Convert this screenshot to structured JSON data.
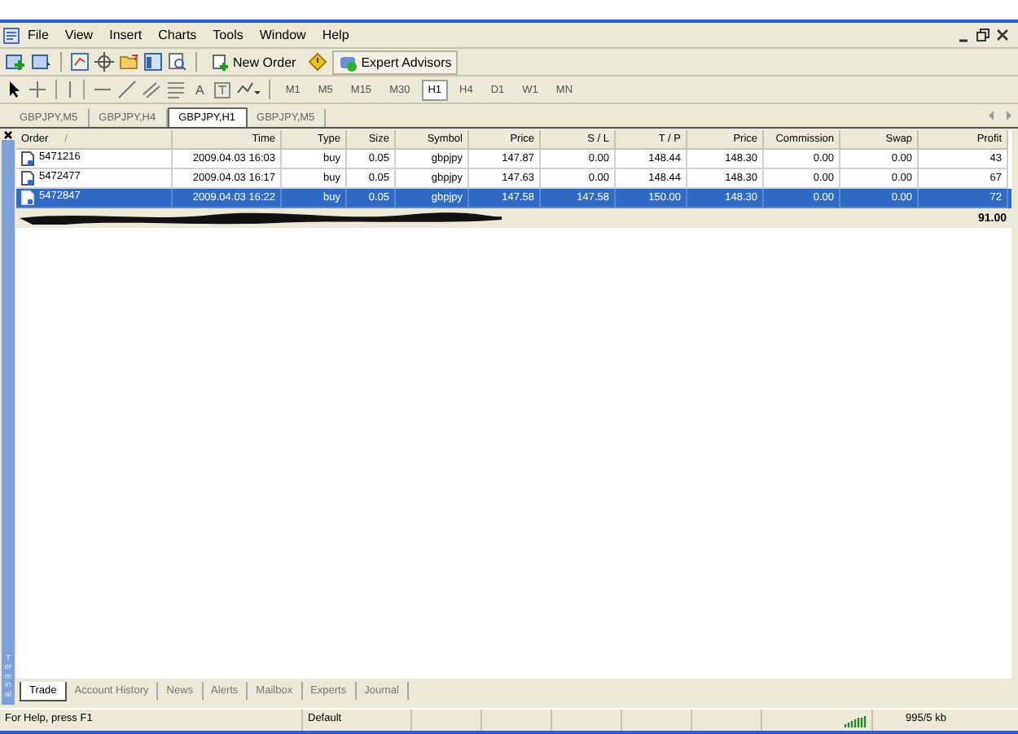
{
  "menu": [
    "File",
    "View",
    "Insert",
    "Charts",
    "Tools",
    "Window",
    "Help"
  ],
  "toolbar": {
    "new_order": "New Order",
    "expert_advisors": "Expert Advisors"
  },
  "draw_tools": {
    "text_tool": "A"
  },
  "timeframes": [
    {
      "label": "M1",
      "selected": false
    },
    {
      "label": "M5",
      "selected": false
    },
    {
      "label": "M15",
      "selected": false
    },
    {
      "label": "M30",
      "selected": false
    },
    {
      "label": "H1",
      "selected": true
    },
    {
      "label": "H4",
      "selected": false
    },
    {
      "label": "D1",
      "selected": false
    },
    {
      "label": "W1",
      "selected": false
    },
    {
      "label": "MN",
      "selected": false
    }
  ],
  "chart_tabs": [
    {
      "label": "GBPJPY,M5",
      "selected": false
    },
    {
      "label": "GBPJPY,H4",
      "selected": false
    },
    {
      "label": "GBPJPY,H1",
      "selected": true
    },
    {
      "label": "GBPJPY,M5",
      "selected": false
    }
  ],
  "terminal": {
    "side_label": "Terminal",
    "columns": [
      "Order",
      "Time",
      "Type",
      "Size",
      "Symbol",
      "Price",
      "S / L",
      "T / P",
      "Price",
      "Commission",
      "Swap",
      "Profit"
    ],
    "sort_mark": "/",
    "rows": [
      {
        "selected": false,
        "cells": [
          "5471216",
          "2009.04.03 16:03",
          "buy",
          "0.05",
          "gbpjpy",
          "147.87",
          "0.00",
          "148.44",
          "148.30",
          "0.00",
          "0.00",
          "43"
        ]
      },
      {
        "selected": false,
        "cells": [
          "5472477",
          "2009.04.03 16:17",
          "buy",
          "0.05",
          "gbpjpy",
          "147.63",
          "0.00",
          "148.44",
          "148.30",
          "0.00",
          "0.00",
          "67"
        ]
      },
      {
        "selected": true,
        "cells": [
          "5472847",
          "2009.04.03 16:22",
          "buy",
          "0.05",
          "gbpjpy",
          "147.58",
          "147.58",
          "150.00",
          "148.30",
          "0.00",
          "0.00",
          "72"
        ]
      }
    ],
    "total": "91.00",
    "tabs": [
      {
        "label": "Trade",
        "selected": true
      },
      {
        "label": "Account History",
        "selected": false
      },
      {
        "label": "News",
        "selected": false
      },
      {
        "label": "Alerts",
        "selected": false
      },
      {
        "label": "Mailbox",
        "selected": false
      },
      {
        "label": "Experts",
        "selected": false
      },
      {
        "label": "Journal",
        "selected": false
      }
    ]
  },
  "status_bar": {
    "help": "For Help, press F1",
    "profile": "Default",
    "traffic": "995/5 kb"
  }
}
